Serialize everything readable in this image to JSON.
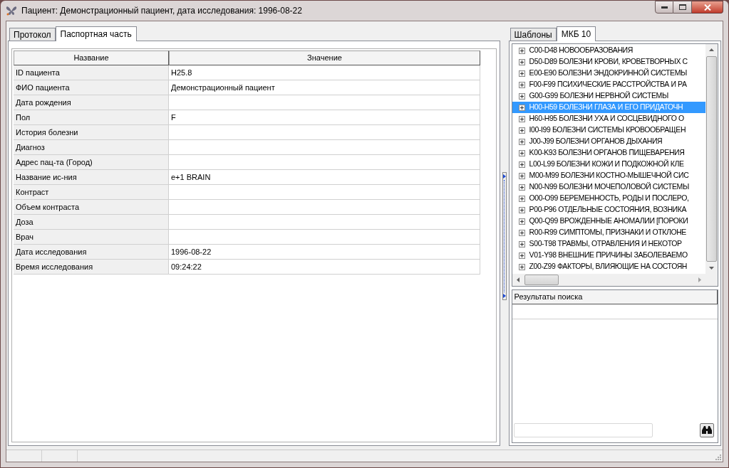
{
  "window": {
    "title": "Пациент: Демонстрационный пациент, дата исследования: 1996-08-22"
  },
  "left_tabs": [
    {
      "label": "Протокол",
      "selected": false
    },
    {
      "label": "Паспортная часть",
      "selected": true
    }
  ],
  "table": {
    "columns": [
      "Название",
      "Значение"
    ],
    "rows": [
      {
        "name": "ID пациента",
        "value": "H25.8"
      },
      {
        "name": "ФИО пациента",
        "value": "Демонстрационный пациент"
      },
      {
        "name": "Дата рождения",
        "value": ""
      },
      {
        "name": "Пол",
        "value": "F"
      },
      {
        "name": "История болезни",
        "value": ""
      },
      {
        "name": "Диагноз",
        "value": ""
      },
      {
        "name": "Адрес пац-та (Город)",
        "value": ""
      },
      {
        "name": "Название ис-ния",
        "value": "e+1 BRAIN"
      },
      {
        "name": "Контраст",
        "value": ""
      },
      {
        "name": "Объем контраста",
        "value": ""
      },
      {
        "name": "Доза",
        "value": ""
      },
      {
        "name": "Врач",
        "value": ""
      },
      {
        "name": "Дата исследования",
        "value": "1996-08-22"
      },
      {
        "name": "Время исследования",
        "value": "09:24:22"
      }
    ]
  },
  "right_tabs": [
    {
      "label": "Шаблоны",
      "selected": false
    },
    {
      "label": "МКБ 10",
      "selected": true
    }
  ],
  "tree": {
    "items": [
      {
        "label": "C00-D48 НОВООБРАЗОВАНИЯ",
        "selected": false,
        "expanded": false
      },
      {
        "label": "D50-D89 БОЛЕЗНИ КРОВИ, КРОВЕТВОРНЫХ С",
        "selected": false,
        "expanded": false
      },
      {
        "label": "E00-E90 БОЛЕЗНИ ЭНДОКРИННОЙ СИСТЕМЫ",
        "selected": false,
        "expanded": false
      },
      {
        "label": "F00-F99 ПСИХИЧЕСКИЕ РАССТРОЙСТВА И РА",
        "selected": false,
        "expanded": false
      },
      {
        "label": "G00-G99 БОЛЕЗНИ НЕРВНОЙ СИСТЕМЫ",
        "selected": false,
        "expanded": false
      },
      {
        "label": "H00-H59 БОЛЕЗНИ ГЛАЗА И ЕГО ПРИДАТОЧН",
        "selected": true,
        "expanded": false
      },
      {
        "label": "H60-H95 БОЛЕЗНИ УХА И СОСЦЕВИДНОГО О",
        "selected": false,
        "expanded": false
      },
      {
        "label": "I00-I99 БОЛЕЗНИ СИСТЕМЫ КРОВООБРАЩЕН",
        "selected": false,
        "expanded": false
      },
      {
        "label": "J00-J99 БОЛЕЗНИ ОРГАНОВ ДЫХАНИЯ",
        "selected": false,
        "expanded": false
      },
      {
        "label": "K00-K93 БОЛЕЗНИ ОРГАНОВ ПИЩЕВАРЕНИЯ",
        "selected": false,
        "expanded": false
      },
      {
        "label": "L00-L99 БОЛЕЗНИ КОЖИ И ПОДКОЖНОЙ КЛЕ",
        "selected": false,
        "expanded": false
      },
      {
        "label": "M00-M99 БОЛЕЗНИ КОСТНО-МЫШЕЧНОЙ СИС",
        "selected": false,
        "expanded": false
      },
      {
        "label": "N00-N99 БОЛЕЗНИ МОЧЕПОЛОВОЙ СИСТЕМЫ",
        "selected": false,
        "expanded": false
      },
      {
        "label": "O00-O99 БЕРЕМЕННОСТЬ, РОДЫ И ПОСЛЕРО,",
        "selected": false,
        "expanded": false
      },
      {
        "label": "P00-P96 ОТДЕЛЬНЫЕ СОСТОЯНИЯ, ВОЗНИКА",
        "selected": false,
        "expanded": false
      },
      {
        "label": "Q00-Q99 ВРОЖДЕННЫЕ АНОМАЛИИ [ПОРОКИ",
        "selected": false,
        "expanded": false
      },
      {
        "label": "R00-R99 СИМПТОМЫ, ПРИЗНАКИ И ОТКЛОНЕ",
        "selected": false,
        "expanded": false
      },
      {
        "label": "S00-T98 ТРАВМЫ, ОТРАВЛЕНИЯ И НЕКОТОР",
        "selected": false,
        "expanded": false
      },
      {
        "label": "V01-Y98 ВНЕШНИЕ ПРИЧИНЫ ЗАБОЛЕВАЕМО",
        "selected": false,
        "expanded": false
      },
      {
        "label": "Z00-Z99 ФАКТОРЫ, ВЛИЯЮЩИЕ НА СОСТОЯН",
        "selected": false,
        "expanded": false
      }
    ]
  },
  "search_results": {
    "header": "Результаты поиска"
  }
}
